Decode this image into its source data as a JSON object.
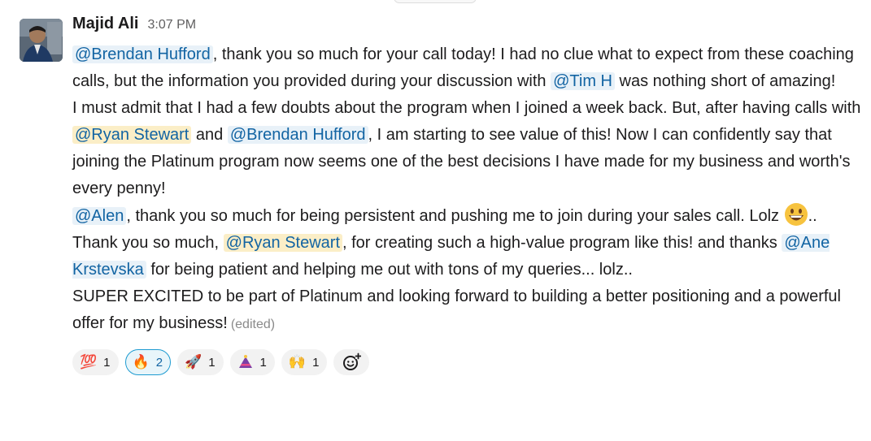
{
  "message": {
    "sender": "Majid Ali",
    "time": "3:07 PM",
    "edited": "(edited)",
    "p1": {
      "m1": "@Brendan Hufford",
      "t1": ", thank you so much for your call today! I had no clue what to expect from these coaching calls, but the information you provided during your discussion with ",
      "m2": "@Tim H",
      "t2": " was nothing short of amazing!"
    },
    "p2": {
      "t1": "I must admit that I had a few doubts about the program when I joined a week back. But, after having calls with ",
      "m1": "@Ryan Stewart",
      "t2": " and ",
      "m2": "@Brendan Hufford",
      "t3": ", I am starting to see value of this! Now I can confidently say that joining the Platinum program now seems one of the best decisions I have made for my business and worth's every penny!"
    },
    "p3": {
      "m1": "@Alen",
      "t1": ", thank you so much for being persistent and pushing me to join during your sales call. Lolz ",
      "emoji": "grinning-face-emoji",
      "t2": ".."
    },
    "p4": {
      "t1": "Thank you so much, ",
      "m1": "@Ryan Stewart",
      "t2": ", for creating such a high-value program like this! and thanks ",
      "m2": "@Ane Krstevska",
      "t3": " for being patient and helping me out with tons of my queries... lolz.."
    },
    "p5": {
      "t1": "SUPER EXCITED to be part of Platinum and looking forward to building a better positioning and a powerful offer for my business!"
    }
  },
  "reactions": [
    {
      "emoji": "💯",
      "icon": "hundred-points-icon",
      "count": "1",
      "active": false
    },
    {
      "emoji": "🔥",
      "icon": "fire-icon",
      "count": "2",
      "active": true
    },
    {
      "emoji": "🚀",
      "icon": "rocket-icon",
      "count": "1",
      "active": false
    },
    {
      "emoji": "",
      "icon": "party-hat-icon",
      "count": "1",
      "active": false
    },
    {
      "emoji": "🙌",
      "icon": "raising-hands-icon",
      "count": "1",
      "active": false
    }
  ],
  "colors": {
    "mention_text": "#1264a3",
    "mention_bg": "#e8f1f8",
    "self_mention_bg": "#fbeec7",
    "active_reaction_border": "#1d9bd1"
  }
}
